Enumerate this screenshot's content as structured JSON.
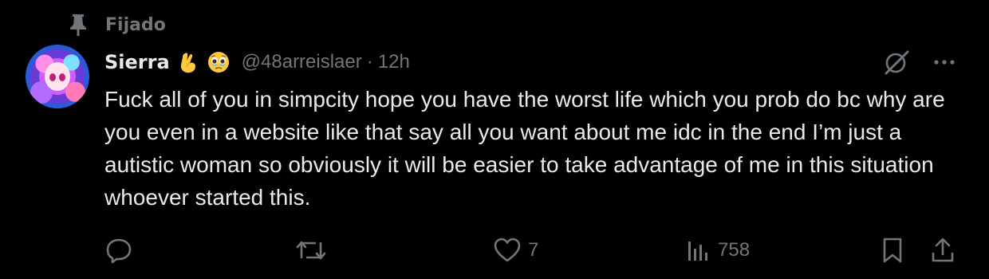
{
  "pinned": {
    "label": "Fijado",
    "icon": "pin-icon"
  },
  "tweet": {
    "display_name": "Sierra",
    "emojis": [
      "hand-with-index-finger-and-thumb-crossed-emoji",
      "face-holding-back-tears-emoji"
    ],
    "handle": "@48arreislaer",
    "separator": "·",
    "time": "12h",
    "text": "Fuck all of you in simpcity hope you have the worst life which you prob do bc why are you even in a website like that say all you want about me idc in the end I’m just a autistic woman so obviously it will be easier to take advantage of me in this situation whoever started this."
  },
  "actions": {
    "reply": {
      "icon": "reply-icon",
      "count": ""
    },
    "repost": {
      "icon": "repost-icon",
      "count": ""
    },
    "like": {
      "icon": "heart-icon",
      "count": "7"
    },
    "views": {
      "icon": "analytics-icon",
      "count": "758"
    },
    "bookmark": {
      "icon": "bookmark-icon"
    },
    "share": {
      "icon": "share-icon"
    }
  },
  "header_icons": {
    "grok": "grok-icon",
    "more": "more-icon"
  },
  "colors": {
    "background": "#000000",
    "primary_text": "#e7e9ea",
    "secondary_text": "#71767b"
  }
}
